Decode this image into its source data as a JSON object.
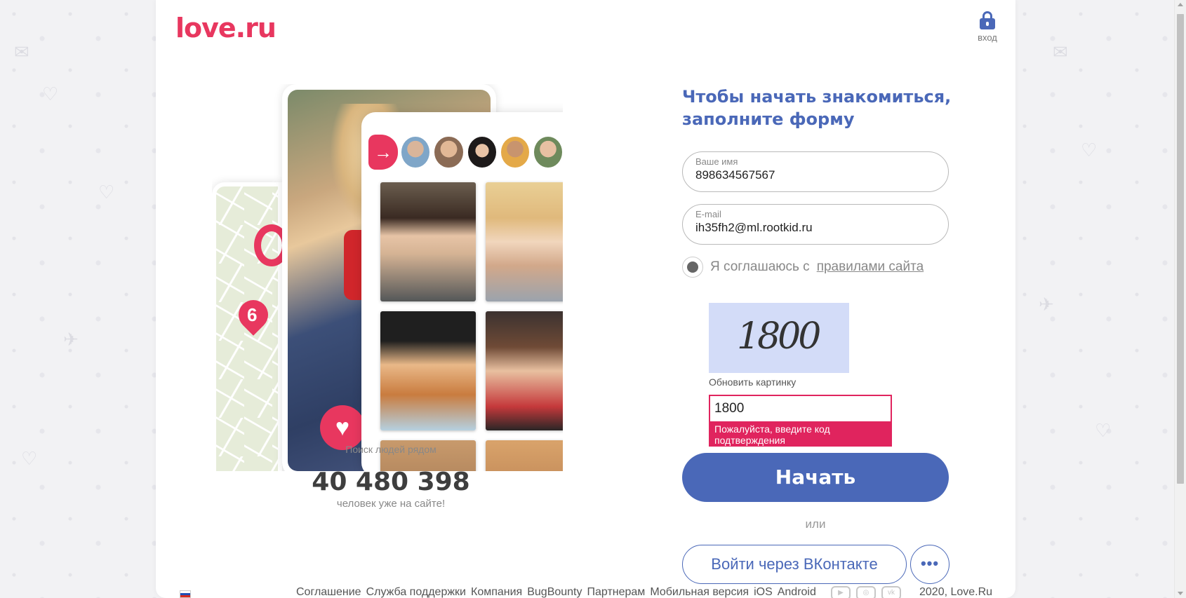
{
  "header": {
    "logo": "love.ru",
    "login_label": "вход"
  },
  "promo": {
    "map_pin_number": "6",
    "search_caption": "Поиск людей рядом",
    "users_count": "40 480 398",
    "users_caption": "человек уже на сайте!"
  },
  "form": {
    "title": "Чтобы начать знакомиться, заполните форму",
    "name_label": "Ваше имя",
    "name_value": "898634567567",
    "email_label": "E-mail",
    "email_value": "ih35fh2@ml.rootkid.ru",
    "agree_text": "Я соглашаюсь с",
    "agree_link": "правилами сайта",
    "captcha_text": "1800",
    "refresh_label": "Обновить картинку",
    "captcha_value": "1800",
    "captcha_error": "Пожалуйста, введите код подтверждения",
    "start_label": "Начать",
    "or_label": "или",
    "vk_label": "Войти через ВКонтакте",
    "more_label": "•••"
  },
  "footer": {
    "links": [
      "Соглашение",
      "Служба поддержки",
      "Компания",
      "BugBounty",
      "Партнерам",
      "Мобильная версия",
      "iOS",
      "Android"
    ],
    "social_icons": [
      "youtube-icon",
      "instagram-icon",
      "vk-icon"
    ],
    "copyright": "2020, Love.Ru"
  },
  "colors": {
    "brand_pink": "#e8375f",
    "accent_blue": "#4a68b8",
    "error_red": "#e0245e"
  }
}
